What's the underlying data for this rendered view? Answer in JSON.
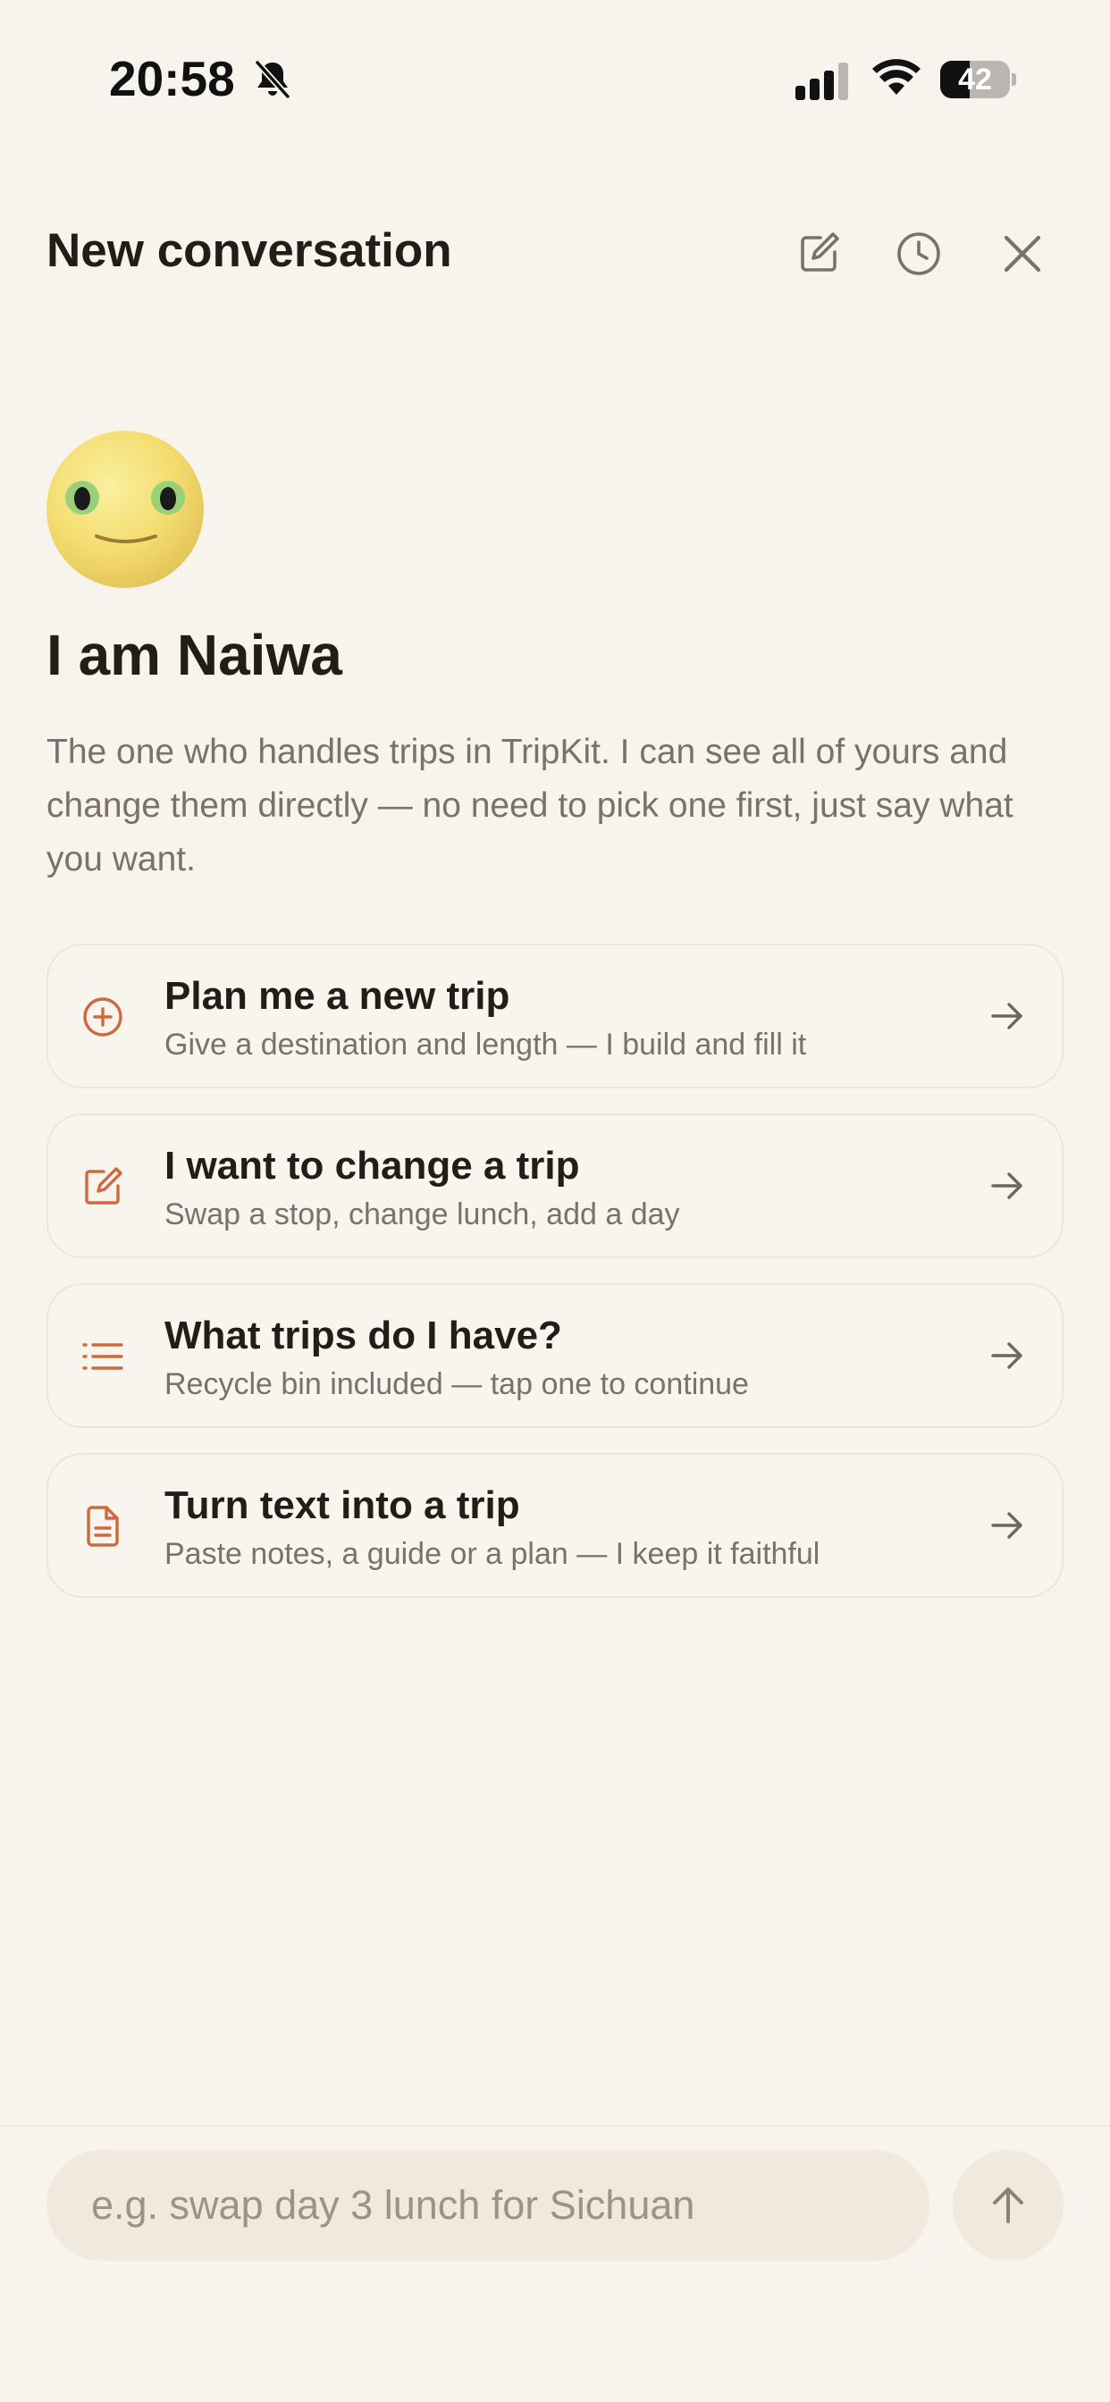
{
  "status_bar": {
    "time": "20:58",
    "battery": "42",
    "battery_percent": 42
  },
  "header": {
    "title": "New conversation",
    "icons": [
      "compose-icon",
      "history-icon",
      "close-icon"
    ]
  },
  "hero": {
    "title": "I am Naiwa",
    "description": "The one who handles trips in TripKit. I can see all of yours and change them directly — no need to pick one first, just say what you want."
  },
  "suggestions": [
    {
      "icon": "plus-circle-icon",
      "title": "Plan me a new trip",
      "subtitle": "Give a destination and length — I build and fill it"
    },
    {
      "icon": "edit-icon",
      "title": "I want to change a trip",
      "subtitle": "Swap a stop, change lunch, add a day"
    },
    {
      "icon": "list-icon",
      "title": "What trips do I have?",
      "subtitle": "Recycle bin included — tap one to continue"
    },
    {
      "icon": "document-icon",
      "title": "Turn text into a trip",
      "subtitle": "Paste notes, a guide or a plan — I keep it faithful"
    }
  ],
  "composer": {
    "placeholder": "e.g. swap day 3 lunch for Sichuan",
    "value": ""
  },
  "colors": {
    "background": "#f7f4ee",
    "accent": "#d0683f",
    "text": "#231d16",
    "muted": "#7a7168",
    "input": "#f1e9de"
  }
}
